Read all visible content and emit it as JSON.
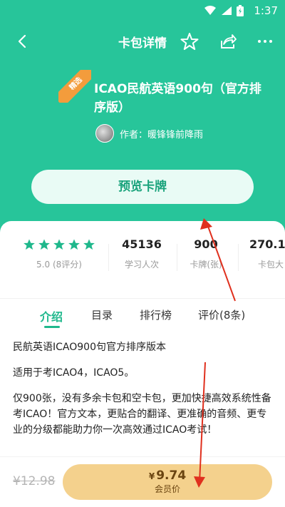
{
  "status_bar": {
    "time": "1:37"
  },
  "navbar": {
    "title": "卡包详情"
  },
  "card": {
    "badge": "精选",
    "title": "ICAO民航英语900句（官方排序版）",
    "author": "作者：暖锋锋前降雨"
  },
  "preview_button": "预览卡牌",
  "stats": {
    "rating_value": 5,
    "rating": "5.0 (8评分)",
    "learners": "45136",
    "learners_label": "学习人次",
    "cards": "900",
    "cards_label": "卡牌(张)",
    "size": "270.1",
    "size_label": "卡包大"
  },
  "tabs": [
    {
      "label": "介绍"
    },
    {
      "label": "目录"
    },
    {
      "label": "排行榜"
    },
    {
      "label": "评价(8条)"
    }
  ],
  "description": [
    "民航英语ICAO900句官方排序版本",
    "适用于考ICAO4，ICAO5。",
    "仅900张，没有多余卡包和空卡包，更加快捷高效系统性备考ICAO！官方文本，更贴合的翻译、更准确的音频、更专业的分级都能助力你一次高效通过ICAO考试！"
  ],
  "bottom": {
    "old_price": "¥12.98",
    "member_price_currency": "¥",
    "member_price": "9.74",
    "member_label": "会员价"
  },
  "colors": {
    "brand": "#27c59a",
    "accent": "#1fb88c",
    "gold": "#f4d18d",
    "badge": "#f39c3c",
    "annotation": "#e0301e"
  },
  "icons": [
    "back-icon",
    "star-outline-icon",
    "share-icon",
    "more-icon",
    "wifi-icon",
    "signal-icon",
    "battery-icon",
    "star-icon"
  ]
}
